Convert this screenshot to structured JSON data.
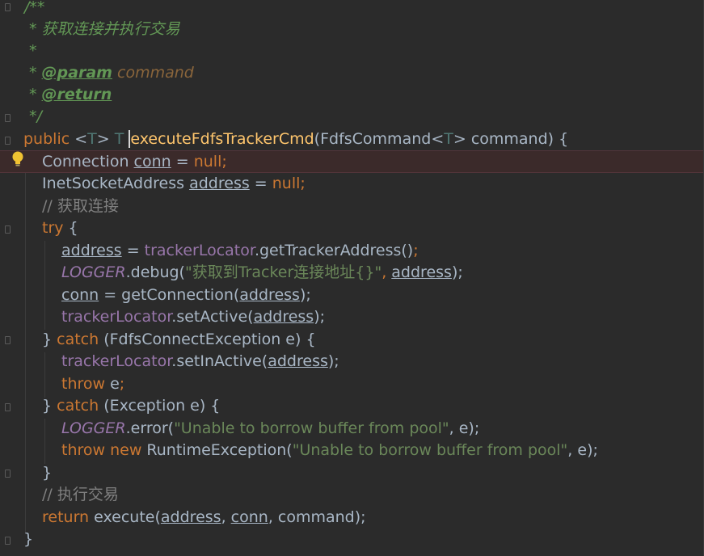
{
  "lines": [
    {
      "id": "l1",
      "tokens": [
        "/**"
      ]
    },
    {
      "id": "l2",
      "tokens": [
        "* 获取连接并执行交易"
      ]
    },
    {
      "id": "l3",
      "tokens": [
        "*"
      ]
    },
    {
      "id": "l4",
      "tokens": [
        "* ",
        "@param",
        " command"
      ]
    },
    {
      "id": "l5",
      "tokens": [
        "* ",
        "@return"
      ]
    },
    {
      "id": "l6",
      "tokens": [
        "*/"
      ]
    },
    {
      "id": "l7",
      "tokens": [
        "public",
        " <",
        "T",
        "> ",
        "T",
        " ",
        "executeFdfsTrackerCmd",
        "(FdfsCommand<",
        "T",
        "> command) {"
      ]
    },
    {
      "id": "l8",
      "tokens": [
        "Connection ",
        "conn",
        " = ",
        "null",
        ";"
      ]
    },
    {
      "id": "l9",
      "tokens": [
        "InetSocketAddress ",
        "address",
        " = ",
        "null",
        ";"
      ]
    },
    {
      "id": "l10",
      "tokens": [
        "// 获取连接"
      ]
    },
    {
      "id": "l11",
      "tokens": [
        "try",
        " {"
      ]
    },
    {
      "id": "l12",
      "tokens": [
        "address",
        " = ",
        "trackerLocator",
        ".getTrackerAddress()",
        ";"
      ]
    },
    {
      "id": "l13",
      "tokens": [
        "LOGGER",
        ".debug(",
        "\"获取到Tracker连接地址{}\"",
        ", ",
        "address",
        ");"
      ]
    },
    {
      "id": "l14",
      "tokens": [
        "conn",
        " = getConnection(",
        "address",
        ");"
      ]
    },
    {
      "id": "l15",
      "tokens": [
        "trackerLocator",
        ".setActive(",
        "address",
        ");"
      ]
    },
    {
      "id": "l16",
      "tokens": [
        "} ",
        "catch",
        " (FdfsConnectException e) {"
      ]
    },
    {
      "id": "l17",
      "tokens": [
        "trackerLocator",
        ".setInActive(",
        "address",
        ");"
      ]
    },
    {
      "id": "l18",
      "tokens": [
        "throw",
        " e",
        ";"
      ]
    },
    {
      "id": "l19",
      "tokens": [
        "} ",
        "catch",
        " (Exception e) {"
      ]
    },
    {
      "id": "l20",
      "tokens": [
        "LOGGER",
        ".error(",
        "\"Unable to borrow buffer from pool\"",
        ", e);"
      ]
    },
    {
      "id": "l21",
      "tokens": [
        "throw new",
        " RuntimeException(",
        "\"Unable to borrow buffer from pool\"",
        ", e);"
      ]
    },
    {
      "id": "l22",
      "tokens": [
        "}"
      ]
    },
    {
      "id": "l23",
      "tokens": [
        "// 执行交易"
      ]
    },
    {
      "id": "l24",
      "tokens": [
        "return",
        " execute(",
        "address",
        ", ",
        "conn",
        ", command);"
      ]
    },
    {
      "id": "l25",
      "tokens": [
        "}"
      ]
    }
  ],
  "icons": {
    "bulb": "lightbulb-icon",
    "fold": "fold-marker-icon"
  },
  "colors": {
    "background": "#2b2b2b",
    "keyword": "#cc7832",
    "doc_comment": "#629755",
    "comment": "#808080",
    "method_decl": "#ffc66d",
    "field": "#9876aa",
    "string": "#6a8759",
    "type_param": "#507874",
    "plain": "#a9b7c6",
    "highlight_line": "#3b2a2a"
  }
}
